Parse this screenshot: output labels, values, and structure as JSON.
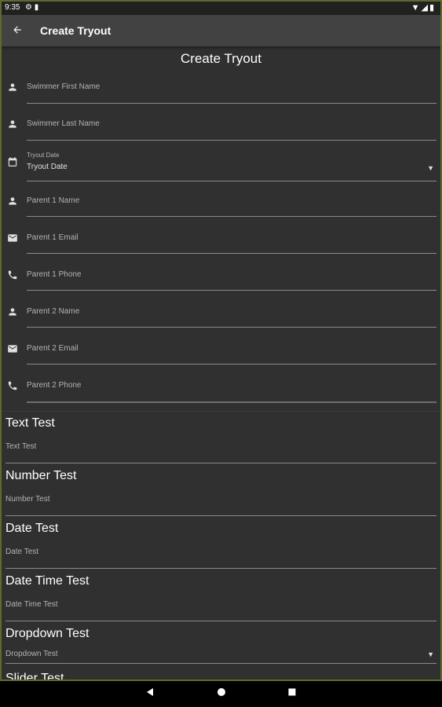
{
  "status_bar": {
    "time": "9:35",
    "left_icons": [
      "settings-icon",
      "sim-icon"
    ],
    "right_icons": [
      "wifi-icon",
      "signal-icon",
      "battery-icon"
    ]
  },
  "app_bar": {
    "title": "Create Tryout",
    "back_icon": "arrow-back-icon"
  },
  "form": {
    "title": "Create Tryout",
    "fields": [
      {
        "label": "Swimmer First Name",
        "icon": "person-icon"
      },
      {
        "label": "Swimmer Last Name",
        "icon": "person-icon"
      },
      {
        "label": "Tryout Date",
        "icon": "calendar-icon",
        "value": "Tryout Date",
        "type": "dropdown"
      },
      {
        "label": "Parent 1 Name",
        "icon": "person-icon"
      },
      {
        "label": "Parent 1 Email",
        "icon": "email-icon"
      },
      {
        "label": "Parent 1 Phone",
        "icon": "phone-icon"
      },
      {
        "label": "Parent 2 Name",
        "icon": "person-icon"
      },
      {
        "label": "Parent 2 Email",
        "icon": "email-icon"
      },
      {
        "label": "Parent 2 Phone",
        "icon": "phone-icon"
      }
    ],
    "sections": [
      {
        "heading": "Text Test",
        "placeholder": "Text Test"
      },
      {
        "heading": "Number Test",
        "placeholder": "Number Test"
      },
      {
        "heading": "Date Test",
        "placeholder": "Date Test"
      },
      {
        "heading": "Date Time Test",
        "placeholder": "Date Time Test"
      },
      {
        "heading": "Dropdown Test",
        "placeholder": "Dropdown Test",
        "type": "dropdown"
      },
      {
        "heading": "Slider Test"
      }
    ]
  },
  "nav_bar": {
    "buttons": [
      "back-triangle-icon",
      "home-circle-icon",
      "recents-square-icon"
    ]
  },
  "colors": {
    "background": "#303030",
    "app_bar": "#424242",
    "status_bar": "#212121",
    "frame_border": "#5c6b2c",
    "text_primary": "#ffffff",
    "text_secondary": "#b3b3b3",
    "underline": "#8a8a8a"
  }
}
